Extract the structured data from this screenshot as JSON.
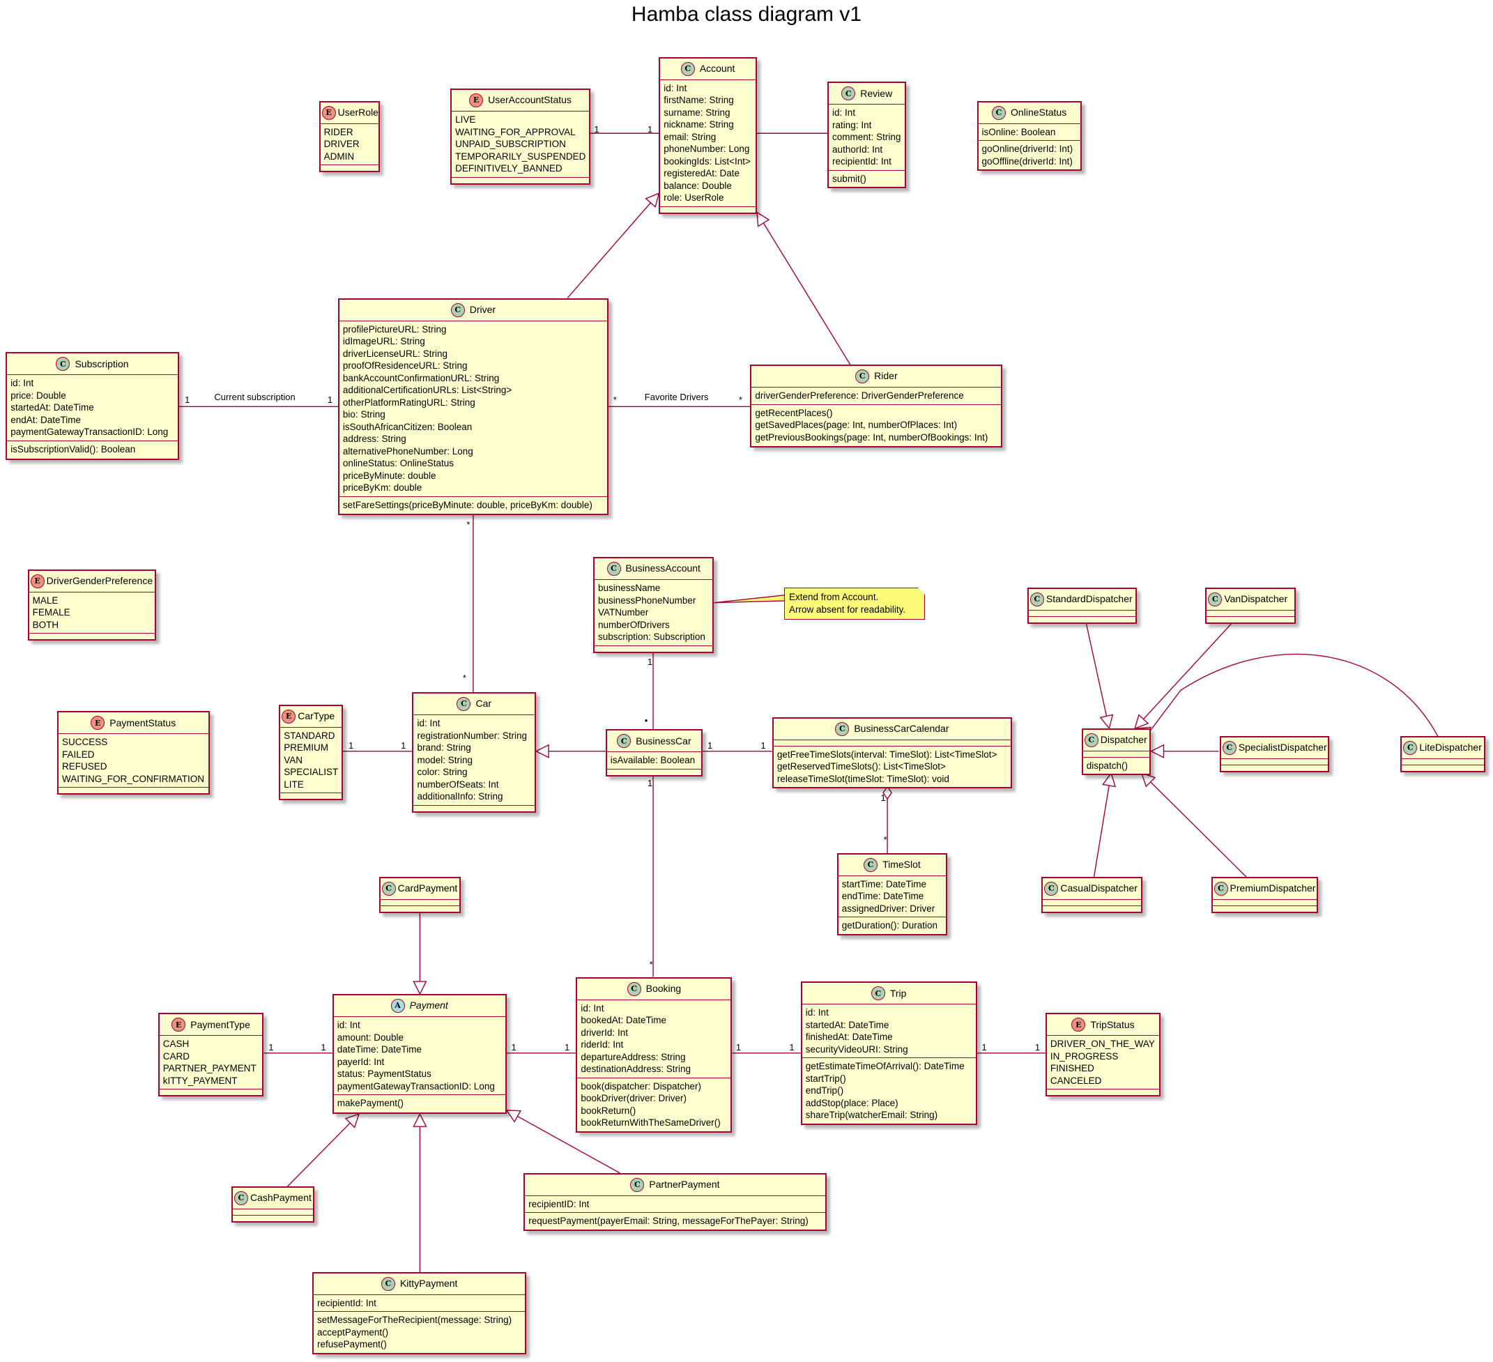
{
  "title": "Hamba class diagram v1",
  "colors": {
    "border": "#A80036",
    "fill": "#FEFECE",
    "note_fill": "#FBFB77",
    "class_icon": "#ADD1B2",
    "enum_icon": "#EB937F",
    "abstract_icon": "#A9DCDF"
  },
  "classes": {
    "UserRole": {
      "kind": "enum",
      "name": "UserRole",
      "fields": [
        "RIDER",
        "DRIVER",
        "ADMIN"
      ],
      "methods": []
    },
    "UserAccountStatus": {
      "kind": "enum",
      "name": "UserAccountStatus",
      "fields": [
        "LIVE",
        "WAITING_FOR_APPROVAL",
        "UNPAID_SUBSCRIPTION",
        "TEMPORARILY_SUSPENDED",
        "DEFINITIVELY_BANNED"
      ],
      "methods": []
    },
    "Account": {
      "kind": "class",
      "name": "Account",
      "fields": [
        "id: Int",
        "firstName: String",
        "surname: String",
        "nickname: String",
        "email: String",
        "phoneNumber: Long",
        "bookingIds: List<Int>",
        "registeredAt: Date",
        "balance: Double",
        "role: UserRole"
      ],
      "methods": []
    },
    "Review": {
      "kind": "class",
      "name": "Review",
      "fields": [
        "id: Int",
        "rating: Int",
        "comment: String",
        "authorId: Int",
        "recipientId: Int"
      ],
      "methods": [
        "submit()"
      ]
    },
    "OnlineStatus": {
      "kind": "class",
      "name": "OnlineStatus",
      "fields": [
        "isOnline: Boolean"
      ],
      "methods": [
        "goOnline(driverId: Int)",
        "goOffline(driverId: Int)"
      ]
    },
    "Subscription": {
      "kind": "class",
      "name": "Subscription",
      "fields": [
        "id: Int",
        "price: Double",
        "startedAt: DateTime",
        "endAt: DateTime",
        "paymentGatewayTransactionID: Long"
      ],
      "methods": [
        "isSubscriptionValid(): Boolean"
      ]
    },
    "Driver": {
      "kind": "class",
      "name": "Driver",
      "fields": [
        "profilePictureURL: String",
        "idImageURL: String",
        "driverLicenseURL: String",
        "proofOfResidenceURL: String",
        "bankAccountConfirmationURL: String",
        "additionalCertificationURLs: List<String>",
        "otherPlatformRatingURL: String",
        "bio: String",
        "isSouthAfricanCitizen: Boolean",
        "address: String",
        "alternativePhoneNumber: Long",
        "onlineStatus: OnlineStatus",
        "priceByMinute: double",
        "priceByKm: double"
      ],
      "methods": [
        "setFareSettings(priceByMinute: double, priceByKm: double)"
      ]
    },
    "Rider": {
      "kind": "class",
      "name": "Rider",
      "fields": [
        "driverGenderPreference: DriverGenderPreference"
      ],
      "methods": [
        "getRecentPlaces()",
        "getSavedPlaces(page: Int, numberOfPlaces: Int)",
        "getPreviousBookings(page: Int, numberOfBookings: Int)"
      ]
    },
    "DriverGenderPreference": {
      "kind": "enum",
      "name": "DriverGenderPreference",
      "fields": [
        "MALE",
        "FEMALE",
        "BOTH"
      ],
      "methods": []
    },
    "BusinessAccount": {
      "kind": "class",
      "name": "BusinessAccount",
      "fields": [
        "businessName",
        "businessPhoneNumber",
        "VATNumber",
        "numberOfDrivers",
        "subscription: Subscription"
      ],
      "methods": []
    },
    "PaymentStatus": {
      "kind": "enum",
      "name": "PaymentStatus",
      "fields": [
        "SUCCESS",
        "FAILED",
        "REFUSED",
        "WAITING_FOR_CONFIRMATION"
      ],
      "methods": []
    },
    "CarType": {
      "kind": "enum",
      "name": "CarType",
      "fields": [
        "STANDARD",
        "PREMIUM",
        "VAN",
        "SPECIALIST",
        "LITE"
      ],
      "methods": []
    },
    "Car": {
      "kind": "class",
      "name": "Car",
      "fields": [
        "id: Int",
        "registrationNumber: String",
        "brand: String",
        "model: String",
        "color: String",
        "numberOfSeats: Int",
        "additionalInfo: String"
      ],
      "methods": []
    },
    "BusinessCar": {
      "kind": "class",
      "name": "BusinessCar",
      "fields": [
        "isAvailable: Boolean"
      ],
      "methods": []
    },
    "BusinessCarCalendar": {
      "kind": "class",
      "name": "BusinessCarCalendar",
      "fields": [],
      "methods": [
        "getFreeTimeSlots(interval: TimeSlot): List<TimeSlot>",
        "getReservedTimeSlots(): List<TimeSlot>",
        "releaseTimeSlot(timeSlot: TimeSlot): void"
      ]
    },
    "TimeSlot": {
      "kind": "class",
      "name": "TimeSlot",
      "fields": [
        "startTime: DateTime",
        "endTime: DateTime",
        "assignedDriver: Driver"
      ],
      "methods": [
        "getDuration(): Duration"
      ]
    },
    "StandardDispatcher": {
      "kind": "class",
      "name": "StandardDispatcher",
      "fields": [],
      "methods": []
    },
    "VanDispatcher": {
      "kind": "class",
      "name": "VanDispatcher",
      "fields": [],
      "methods": []
    },
    "Dispatcher": {
      "kind": "class",
      "name": "Dispatcher",
      "fields": [],
      "methods": [
        "dispatch()"
      ]
    },
    "SpecialistDispatcher": {
      "kind": "class",
      "name": "SpecialistDispatcher",
      "fields": [],
      "methods": []
    },
    "LiteDispatcher": {
      "kind": "class",
      "name": "LiteDispatcher",
      "fields": [],
      "methods": []
    },
    "CasualDispatcher": {
      "kind": "class",
      "name": "CasualDispatcher",
      "fields": [],
      "methods": []
    },
    "PremiumDispatcher": {
      "kind": "class",
      "name": "PremiumDispatcher",
      "fields": [],
      "methods": []
    },
    "CardPayment": {
      "kind": "class",
      "name": "CardPayment",
      "fields": [],
      "methods": []
    },
    "PaymentType": {
      "kind": "enum",
      "name": "PaymentType",
      "fields": [
        "CASH",
        "CARD",
        "PARTNER_PAYMENT",
        "kITTY_PAYMENT"
      ],
      "methods": []
    },
    "Payment": {
      "kind": "abstract",
      "name": "Payment",
      "fields": [
        "id: Int",
        "amount: Double",
        "dateTime: DateTime",
        "payerId: Int",
        "status: PaymentStatus",
        "paymentGatewayTransactionID: Long"
      ],
      "methods": [
        "makePayment()"
      ]
    },
    "Booking": {
      "kind": "class",
      "name": "Booking",
      "fields": [
        "id: Int",
        "bookedAt: DateTime",
        "driverId: Int",
        "riderId: Int",
        "departureAddress: String",
        "destinationAddress: String"
      ],
      "methods": [
        "book(dispatcher: Dispatcher)",
        "bookDriver(driver: Driver)",
        "bookReturn()",
        "bookReturnWithTheSameDriver()"
      ]
    },
    "Trip": {
      "kind": "class",
      "name": "Trip",
      "fields": [
        "id: Int",
        "startedAt: DateTime",
        "finishedAt: DateTime",
        "securityVideoURI: String"
      ],
      "methods": [
        "getEstimateTimeOfArrival(): DateTime",
        "startTrip()",
        "endTrip()",
        "addStop(place: Place)",
        "shareTrip(watcherEmail: String)"
      ]
    },
    "TripStatus": {
      "kind": "enum",
      "name": "TripStatus",
      "fields": [
        "DRIVER_ON_THE_WAY",
        "IN_PROGRESS",
        "FINISHED",
        "CANCELED"
      ],
      "methods": []
    },
    "CashPayment": {
      "kind": "class",
      "name": "CashPayment",
      "fields": [],
      "methods": []
    },
    "PartnerPayment": {
      "kind": "class",
      "name": "PartnerPayment",
      "fields": [
        "recipientID: Int"
      ],
      "methods": [
        "requestPayment(payerEmail: String, messageForThePayer: String)"
      ]
    },
    "KittyPayment": {
      "kind": "class",
      "name": "KittyPayment",
      "fields": [
        "recipientId: Int"
      ],
      "methods": [
        "setMessageForTheRecipient(message: String)",
        "acceptPayment()",
        "refusePayment()"
      ]
    }
  },
  "note": {
    "lines": [
      "Extend from Account.",
      "Arrow absent for readability."
    ]
  },
  "relations": [
    {
      "from": "UserAccountStatus",
      "to": "Account",
      "type": "association",
      "from_mult": "1",
      "to_mult": "1",
      "label": ""
    },
    {
      "from": "Account",
      "to": "Review",
      "type": "association",
      "from_mult": "",
      "to_mult": "",
      "label": ""
    },
    {
      "from": "Driver",
      "to": "Account",
      "type": "inheritance",
      "from_mult": "",
      "to_mult": "",
      "label": ""
    },
    {
      "from": "Rider",
      "to": "Account",
      "type": "inheritance",
      "from_mult": "",
      "to_mult": "",
      "label": ""
    },
    {
      "from": "Subscription",
      "to": "Driver",
      "type": "association",
      "from_mult": "1",
      "to_mult": "1",
      "label": "Current subscription"
    },
    {
      "from": "Driver",
      "to": "Rider",
      "type": "association",
      "from_mult": "*",
      "to_mult": "*",
      "label": "Favorite Drivers"
    },
    {
      "from": "Driver",
      "to": "Car",
      "type": "association",
      "from_mult": "*",
      "to_mult": "*",
      "label": ""
    },
    {
      "from": "CarType",
      "to": "Car",
      "type": "association",
      "from_mult": "1",
      "to_mult": "1",
      "label": ""
    },
    {
      "from": "BusinessCar",
      "to": "Car",
      "type": "inheritance",
      "from_mult": "",
      "to_mult": "",
      "label": ""
    },
    {
      "from": "BusinessAccount",
      "to": "BusinessCar",
      "type": "association",
      "from_mult": "1",
      "to_mult": "•",
      "label": ""
    },
    {
      "from": "BusinessCar",
      "to": "BusinessCarCalendar",
      "type": "association",
      "from_mult": "1",
      "to_mult": "1",
      "label": ""
    },
    {
      "from": "BusinessCarCalendar",
      "to": "TimeSlot",
      "type": "aggregation",
      "from_mult": "1",
      "to_mult": "*",
      "label": ""
    },
    {
      "from": "BusinessCar",
      "to": "Booking",
      "type": "association",
      "from_mult": "1",
      "to_mult": "*",
      "label": ""
    },
    {
      "from": "StandardDispatcher",
      "to": "Dispatcher",
      "type": "inheritance"
    },
    {
      "from": "VanDispatcher",
      "to": "Dispatcher",
      "type": "inheritance"
    },
    {
      "from": "LiteDispatcher",
      "to": "Dispatcher",
      "type": "inheritance"
    },
    {
      "from": "SpecialistDispatcher",
      "to": "Dispatcher",
      "type": "inheritance"
    },
    {
      "from": "CasualDispatcher",
      "to": "Dispatcher",
      "type": "inheritance"
    },
    {
      "from": "PremiumDispatcher",
      "to": "Dispatcher",
      "type": "inheritance"
    },
    {
      "from": "CardPayment",
      "to": "Payment",
      "type": "inheritance"
    },
    {
      "from": "PaymentType",
      "to": "Payment",
      "type": "association",
      "from_mult": "1",
      "to_mult": "1",
      "label": ""
    },
    {
      "from": "Payment",
      "to": "Booking",
      "type": "association",
      "from_mult": "1",
      "to_mult": "1",
      "label": ""
    },
    {
      "from": "Booking",
      "to": "Trip",
      "type": "association",
      "from_mult": "1",
      "to_mult": "1",
      "label": ""
    },
    {
      "from": "Trip",
      "to": "TripStatus",
      "type": "association",
      "from_mult": "1",
      "to_mult": "1",
      "label": ""
    },
    {
      "from": "CashPayment",
      "to": "Payment",
      "type": "inheritance"
    },
    {
      "from": "KittyPayment",
      "to": "Payment",
      "type": "inheritance"
    },
    {
      "from": "PartnerPayment",
      "to": "Payment",
      "type": "inheritance"
    },
    {
      "from": "BusinessAccount",
      "to": "Note",
      "type": "note-link"
    }
  ]
}
